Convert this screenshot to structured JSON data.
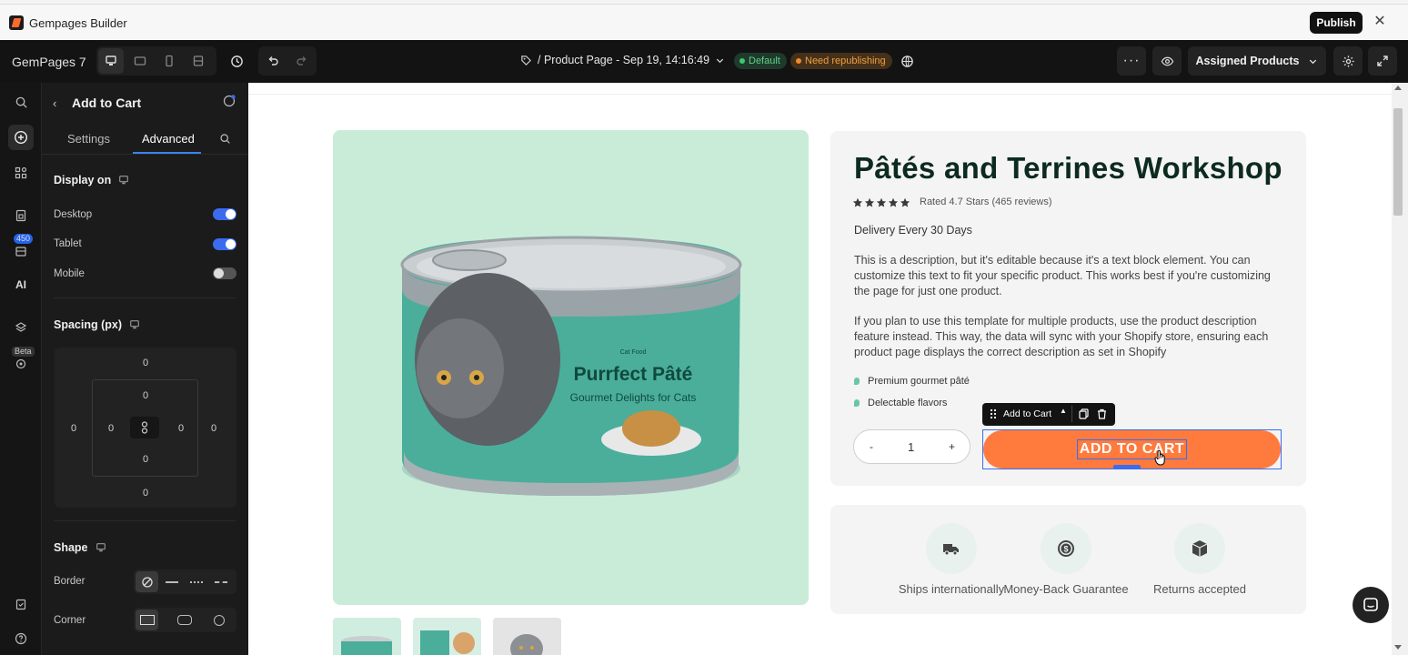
{
  "titlebar": {
    "app_title": "Gempages Builder",
    "publish_label": "Publish"
  },
  "toolbar": {
    "brand": "GemPages 7",
    "page_path": "/ Product Page - Sep 19, 14:16:49",
    "badge_default": "Default",
    "badge_repub": "Need republishing",
    "assigned_label": "Assigned Products"
  },
  "rail": {
    "badge_count": "450",
    "beta_label": "Beta",
    "ai_label": "AI"
  },
  "panel": {
    "title": "Add to Cart",
    "tabs": [
      "Settings",
      "Advanced"
    ],
    "display_on": {
      "title": "Display on",
      "rows": [
        {
          "label": "Desktop",
          "on": true
        },
        {
          "label": "Tablet",
          "on": true
        },
        {
          "label": "Mobile",
          "on": false
        }
      ]
    },
    "spacing": {
      "title": "Spacing (px)",
      "margin_top": "0",
      "margin_right": "0",
      "margin_bottom": "0",
      "margin_left": "0",
      "padding_top": "0",
      "padding_right": "0",
      "padding_bottom": "0",
      "padding_left": "0"
    },
    "shape": {
      "title": "Shape",
      "border_label": "Border",
      "corner_label": "Corner"
    }
  },
  "product": {
    "title": "Pâtés and Terrines Workshop",
    "rating_text": "Rated 4.7 Stars (465 reviews)",
    "stars": 5,
    "delivery": "Delivery Every 30 Days",
    "desc1": "This is a description, but it's editable because it's a text block element. You can customize this text to fit your specific product. This works best if you're customizing the page for just one product.",
    "desc2": "If you plan to use this template for multiple products, use the product description feature instead. This way, the data will sync with your Shopify store, ensuring each product page displays the correct description as set in Shopify",
    "bullets": [
      "Premium gourmet pâté",
      "Delectable flavors"
    ],
    "qty": {
      "minus": "-",
      "value": "1",
      "plus": "+"
    },
    "atc_label": "ADD TO CART",
    "atc_toolbar_label": "Add to Cart",
    "can": {
      "line1": "Purrfect Pâté",
      "line2": "Gourmet Delights for Cats",
      "brand": "Cat Food"
    }
  },
  "trust": [
    {
      "label": "Ships internationally",
      "icon": "truck-icon"
    },
    {
      "label": "Money-Back Guarantee",
      "icon": "money-back-icon"
    },
    {
      "label": "Returns accepted",
      "icon": "box-icon"
    }
  ],
  "colors": {
    "accent": "#3b6cf0",
    "atc": "#ff7a3d",
    "hero_bg": "#c9ecd9",
    "title": "#0d2a1f"
  }
}
